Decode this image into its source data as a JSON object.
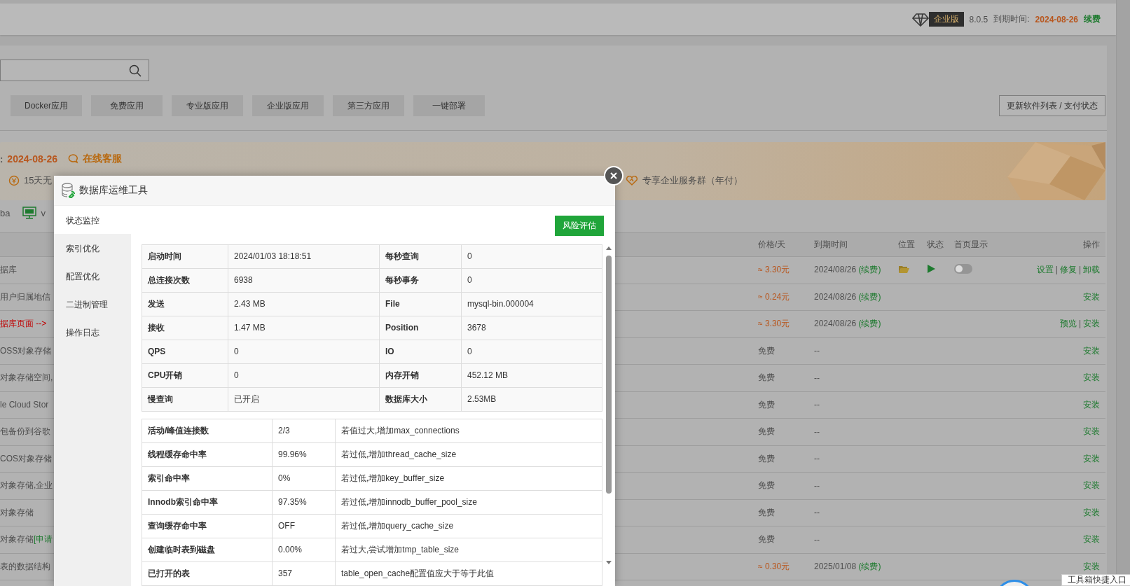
{
  "header": {
    "edition": "企业版",
    "version": "8.0.5",
    "expiry_label": "到期时间:",
    "expiry_date": "2024-08-26",
    "renew": "续费"
  },
  "categories": [
    {
      "label": "Docker应用"
    },
    {
      "label": "免费应用"
    },
    {
      "label": "专业版应用"
    },
    {
      "label": "企业版应用"
    },
    {
      "label": "第三方应用"
    },
    {
      "label": "一键部署"
    }
  ],
  "update_button": "更新软件列表 / 支付状态",
  "banner": {
    "prefix": ":",
    "expiry_date": "2024-08-26",
    "support": "在线客服",
    "features": [
      "15天无",
      "专享企业服务群（年付）"
    ]
  },
  "quick_links": [
    {
      "label": "ba",
      "kind": "plain"
    },
    {
      "label": "v",
      "kind": "ftp"
    }
  ],
  "table": {
    "columns": [
      "价格/天",
      "到期时间",
      "位置",
      "状态",
      "首页显示",
      "操作"
    ],
    "action_separator": "|",
    "rows": [
      {
        "name": "据库",
        "alert": false,
        "price": "≈ 3.30元",
        "paid": true,
        "expiry": "2024/08/26",
        "renew": "(续费)",
        "installed": true,
        "running": true,
        "home_display": false,
        "actions": [
          "设置",
          "修复",
          "卸载"
        ]
      },
      {
        "name": "用户归属地信",
        "alert": false,
        "price": "≈ 0.24元",
        "paid": true,
        "expiry": "2024/08/26",
        "renew": "(续费)",
        "actions": [
          "安装"
        ]
      },
      {
        "name": "据库页面 -->",
        "alert": true,
        "price": "≈ 3.30元",
        "paid": true,
        "expiry": "2024/08/26",
        "renew": "(续费)",
        "actions": [
          "预览",
          "安装"
        ]
      },
      {
        "name": "OSS对象存储",
        "alert": false,
        "price": "免费",
        "paid": false,
        "expiry": "--",
        "actions": [
          "安装"
        ]
      },
      {
        "name": "对象存储空间,",
        "alert": false,
        "price": "免费",
        "paid": false,
        "expiry": "--",
        "actions": [
          "安装"
        ]
      },
      {
        "name": "le Cloud Stor",
        "alert": false,
        "price": "免费",
        "paid": false,
        "expiry": "--",
        "actions": [
          "安装"
        ]
      },
      {
        "name": "包备份到谷歌",
        "alert": false,
        "price": "免费",
        "paid": false,
        "expiry": "--",
        "actions": [
          "安装"
        ]
      },
      {
        "name": "COS对象存储",
        "alert": false,
        "price": "免费",
        "paid": false,
        "expiry": "--",
        "actions": [
          "安装"
        ]
      },
      {
        "name": "对象存储,企业",
        "alert": false,
        "price": "免费",
        "paid": false,
        "expiry": "--",
        "actions": [
          "安装"
        ]
      },
      {
        "name": "对象存储",
        "alert": false,
        "price": "免费",
        "paid": false,
        "expiry": "--",
        "actions": [
          "安装"
        ]
      },
      {
        "name": "对象存储",
        "name_tag": "[申请",
        "alert": false,
        "price": "免费",
        "paid": false,
        "expiry": "--",
        "actions": [
          "安装"
        ]
      },
      {
        "name": "表的数据结构",
        "alert": false,
        "price": "≈ 0.30元",
        "paid": true,
        "expiry": "2025/01/08",
        "renew": "(续费)",
        "actions": [
          "安装"
        ]
      }
    ]
  },
  "dialog": {
    "title": "数据库运维工具",
    "nav": [
      {
        "label": "状态监控",
        "selected": true
      },
      {
        "label": "索引优化",
        "selected": false
      },
      {
        "label": "配置优化",
        "selected": false
      },
      {
        "label": "二进制管理",
        "selected": false
      },
      {
        "label": "操作日志",
        "selected": false
      }
    ],
    "action_button": "风险评估",
    "status_table": [
      [
        "启动时间",
        "2024/01/03 18:18:51",
        "每秒查询",
        "0"
      ],
      [
        "总连接次数",
        "6938",
        "每秒事务",
        "0"
      ],
      [
        "发送",
        "2.43 MB",
        "File",
        "mysql-bin.000004"
      ],
      [
        "接收",
        "1.47 MB",
        "Position",
        "3678"
      ],
      [
        "QPS",
        "0",
        "IO",
        "0"
      ],
      [
        "CPU开销",
        "0",
        "内存开销",
        "452.12 MB"
      ],
      [
        "慢查询",
        "已开启",
        "数据库大小",
        "2.53MB"
      ]
    ],
    "metrics": [
      [
        "活动/峰值连接数",
        "2/3",
        "若值过大,增加max_connections"
      ],
      [
        "线程缓存命中率",
        "99.96%",
        "若过低,增加thread_cache_size"
      ],
      [
        "索引命中率",
        "0%",
        "若过低,增加key_buffer_size"
      ],
      [
        "Innodb索引命中率",
        "97.35%",
        "若过低,增加innodb_buffer_pool_size"
      ],
      [
        "查询缓存命中率",
        "OFF",
        "若过低,增加query_cache_size"
      ],
      [
        "创建临时表到磁盘",
        "0.00%",
        "若过大,尝试增加tmp_table_size"
      ],
      [
        "已打开的表",
        "357",
        "table_open_cache配置值应大于等于此值"
      ]
    ]
  },
  "tooltip": "工具箱快捷入口"
}
